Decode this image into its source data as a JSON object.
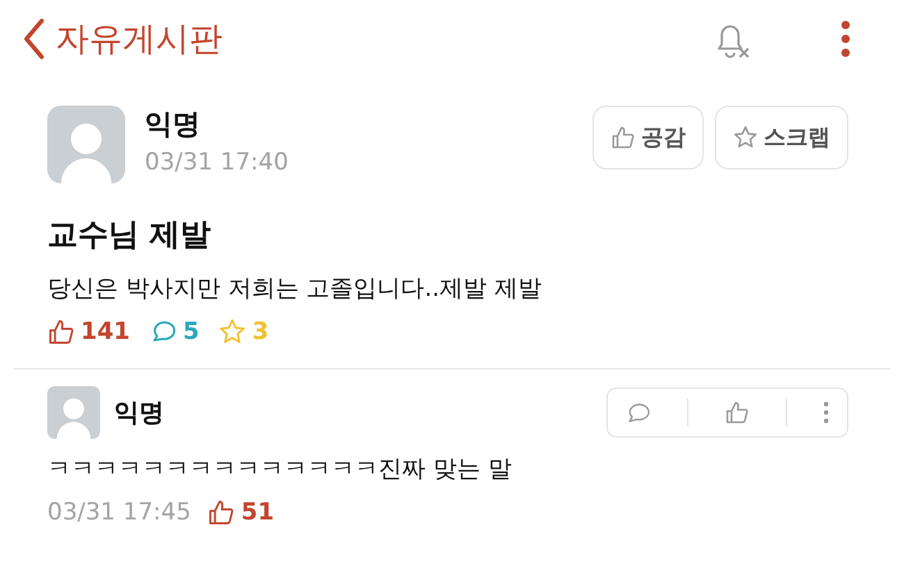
{
  "header": {
    "back": "자유게시판"
  },
  "post": {
    "author": "익명",
    "time": "03/31 17:40",
    "buttons": [
      "공감",
      "스크랩"
    ],
    "title": "교수님 제발",
    "body": "당신은 박사지만 저희는 고졸입니다..제발 제발",
    "likes": "141",
    "comments": "5",
    "scraps": "3"
  },
  "comments": [
    {
      "author": "익명",
      "text": "ㅋㅋㅋㅋㅋㅋㅋㅋㅋㅋㅋㅋㅋㅋ진짜 맞는 말",
      "time": "03/31 17:45",
      "likes": "51"
    }
  ]
}
